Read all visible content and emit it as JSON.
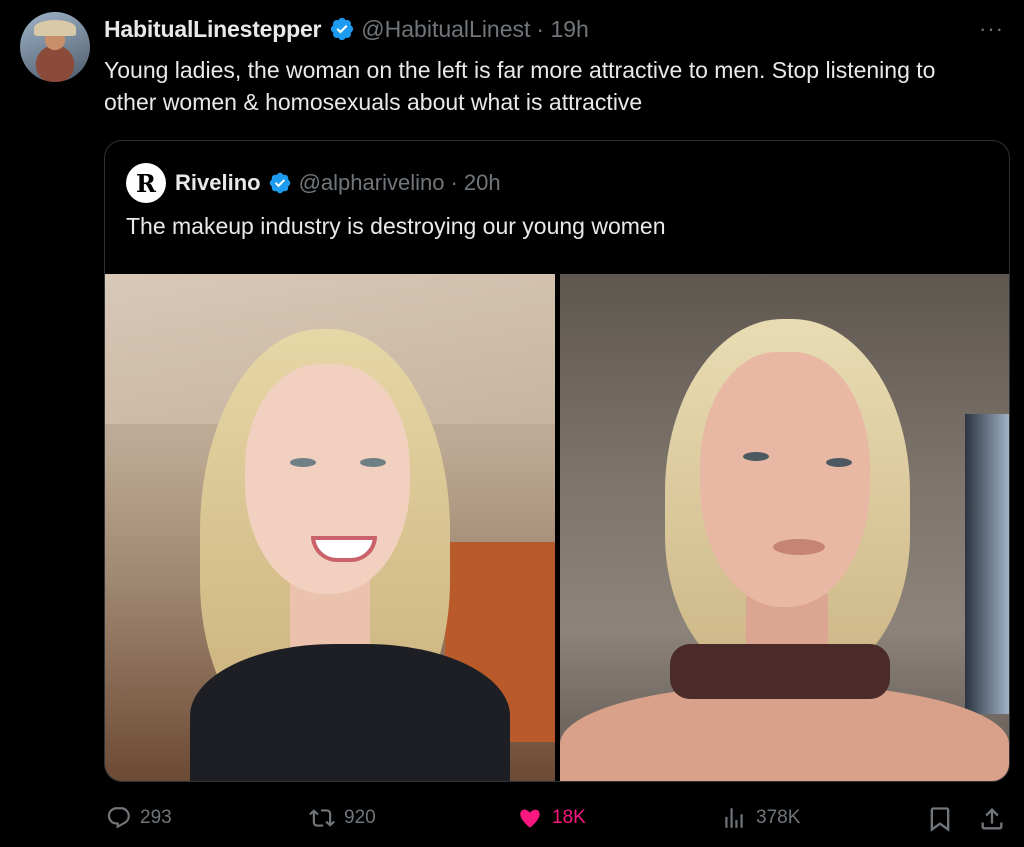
{
  "tweet": {
    "author_name": "HabitualLinestepper",
    "author_handle": "@HabitualLinest",
    "time": "· 19h",
    "more": "···",
    "text": "Young ladies, the woman on the left is far more attractive to men. Stop listening to other women & homosexuals about what is attractive"
  },
  "quote": {
    "logo": "R",
    "author_name": "Rivelino",
    "author_handle": "@alpharivelino",
    "time": "· 20h",
    "text": "The makeup industry is destroying our young women"
  },
  "actions": {
    "replies": "293",
    "reposts": "920",
    "likes": "18K",
    "views": "378K"
  },
  "colors": {
    "background": "#000000",
    "text": "#e7e9ea",
    "muted": "#71767b",
    "verified": "#1d9bf0",
    "like": "#f91880"
  },
  "icons": {
    "avatar": "avatar",
    "verified": "verified-badge-icon",
    "reply": "reply-icon",
    "repost": "repost-icon",
    "like": "heart-icon",
    "views": "views-icon",
    "bookmark": "bookmark-icon",
    "share": "share-icon"
  }
}
